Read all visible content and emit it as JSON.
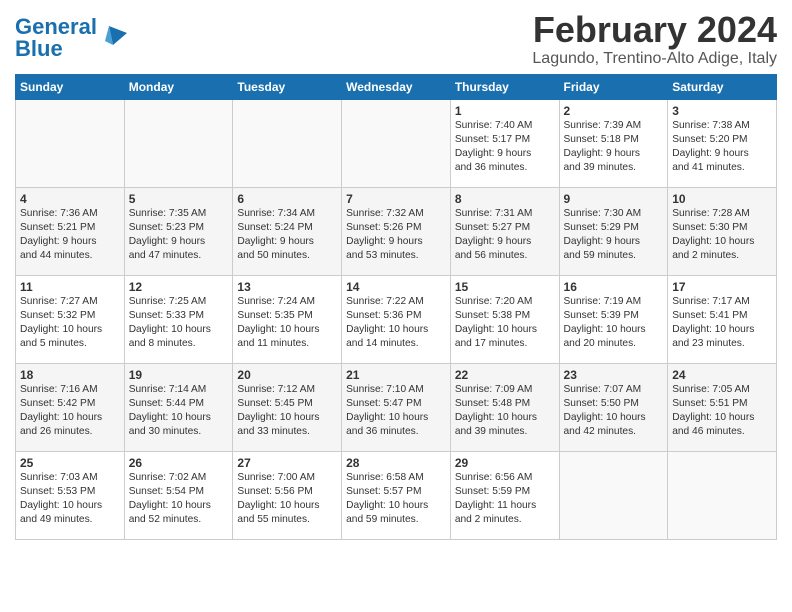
{
  "header": {
    "logo_text_normal": "General",
    "logo_text_colored": "Blue",
    "month_title": "February 2024",
    "location": "Lagundo, Trentino-Alto Adige, Italy"
  },
  "days_of_week": [
    "Sunday",
    "Monday",
    "Tuesday",
    "Wednesday",
    "Thursday",
    "Friday",
    "Saturday"
  ],
  "weeks": [
    [
      {
        "day": "",
        "info": ""
      },
      {
        "day": "",
        "info": ""
      },
      {
        "day": "",
        "info": ""
      },
      {
        "day": "",
        "info": ""
      },
      {
        "day": "1",
        "info": "Sunrise: 7:40 AM\nSunset: 5:17 PM\nDaylight: 9 hours\nand 36 minutes."
      },
      {
        "day": "2",
        "info": "Sunrise: 7:39 AM\nSunset: 5:18 PM\nDaylight: 9 hours\nand 39 minutes."
      },
      {
        "day": "3",
        "info": "Sunrise: 7:38 AM\nSunset: 5:20 PM\nDaylight: 9 hours\nand 41 minutes."
      }
    ],
    [
      {
        "day": "4",
        "info": "Sunrise: 7:36 AM\nSunset: 5:21 PM\nDaylight: 9 hours\nand 44 minutes."
      },
      {
        "day": "5",
        "info": "Sunrise: 7:35 AM\nSunset: 5:23 PM\nDaylight: 9 hours\nand 47 minutes."
      },
      {
        "day": "6",
        "info": "Sunrise: 7:34 AM\nSunset: 5:24 PM\nDaylight: 9 hours\nand 50 minutes."
      },
      {
        "day": "7",
        "info": "Sunrise: 7:32 AM\nSunset: 5:26 PM\nDaylight: 9 hours\nand 53 minutes."
      },
      {
        "day": "8",
        "info": "Sunrise: 7:31 AM\nSunset: 5:27 PM\nDaylight: 9 hours\nand 56 minutes."
      },
      {
        "day": "9",
        "info": "Sunrise: 7:30 AM\nSunset: 5:29 PM\nDaylight: 9 hours\nand 59 minutes."
      },
      {
        "day": "10",
        "info": "Sunrise: 7:28 AM\nSunset: 5:30 PM\nDaylight: 10 hours\nand 2 minutes."
      }
    ],
    [
      {
        "day": "11",
        "info": "Sunrise: 7:27 AM\nSunset: 5:32 PM\nDaylight: 10 hours\nand 5 minutes."
      },
      {
        "day": "12",
        "info": "Sunrise: 7:25 AM\nSunset: 5:33 PM\nDaylight: 10 hours\nand 8 minutes."
      },
      {
        "day": "13",
        "info": "Sunrise: 7:24 AM\nSunset: 5:35 PM\nDaylight: 10 hours\nand 11 minutes."
      },
      {
        "day": "14",
        "info": "Sunrise: 7:22 AM\nSunset: 5:36 PM\nDaylight: 10 hours\nand 14 minutes."
      },
      {
        "day": "15",
        "info": "Sunrise: 7:20 AM\nSunset: 5:38 PM\nDaylight: 10 hours\nand 17 minutes."
      },
      {
        "day": "16",
        "info": "Sunrise: 7:19 AM\nSunset: 5:39 PM\nDaylight: 10 hours\nand 20 minutes."
      },
      {
        "day": "17",
        "info": "Sunrise: 7:17 AM\nSunset: 5:41 PM\nDaylight: 10 hours\nand 23 minutes."
      }
    ],
    [
      {
        "day": "18",
        "info": "Sunrise: 7:16 AM\nSunset: 5:42 PM\nDaylight: 10 hours\nand 26 minutes."
      },
      {
        "day": "19",
        "info": "Sunrise: 7:14 AM\nSunset: 5:44 PM\nDaylight: 10 hours\nand 30 minutes."
      },
      {
        "day": "20",
        "info": "Sunrise: 7:12 AM\nSunset: 5:45 PM\nDaylight: 10 hours\nand 33 minutes."
      },
      {
        "day": "21",
        "info": "Sunrise: 7:10 AM\nSunset: 5:47 PM\nDaylight: 10 hours\nand 36 minutes."
      },
      {
        "day": "22",
        "info": "Sunrise: 7:09 AM\nSunset: 5:48 PM\nDaylight: 10 hours\nand 39 minutes."
      },
      {
        "day": "23",
        "info": "Sunrise: 7:07 AM\nSunset: 5:50 PM\nDaylight: 10 hours\nand 42 minutes."
      },
      {
        "day": "24",
        "info": "Sunrise: 7:05 AM\nSunset: 5:51 PM\nDaylight: 10 hours\nand 46 minutes."
      }
    ],
    [
      {
        "day": "25",
        "info": "Sunrise: 7:03 AM\nSunset: 5:53 PM\nDaylight: 10 hours\nand 49 minutes."
      },
      {
        "day": "26",
        "info": "Sunrise: 7:02 AM\nSunset: 5:54 PM\nDaylight: 10 hours\nand 52 minutes."
      },
      {
        "day": "27",
        "info": "Sunrise: 7:00 AM\nSunset: 5:56 PM\nDaylight: 10 hours\nand 55 minutes."
      },
      {
        "day": "28",
        "info": "Sunrise: 6:58 AM\nSunset: 5:57 PM\nDaylight: 10 hours\nand 59 minutes."
      },
      {
        "day": "29",
        "info": "Sunrise: 6:56 AM\nSunset: 5:59 PM\nDaylight: 11 hours\nand 2 minutes."
      },
      {
        "day": "",
        "info": ""
      },
      {
        "day": "",
        "info": ""
      }
    ]
  ]
}
